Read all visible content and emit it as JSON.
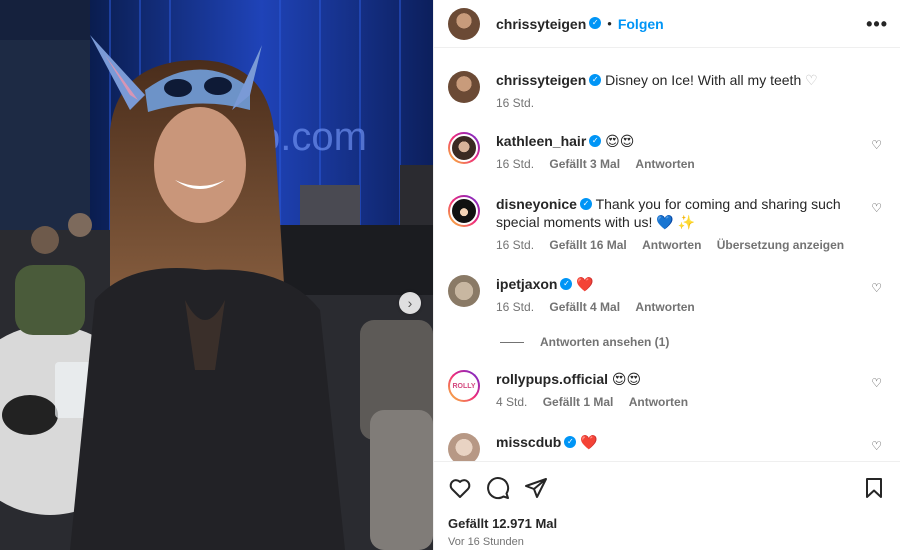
{
  "post": {
    "author": "chrissyteigen",
    "follow_label": "Folgen",
    "more_label": "•••",
    "carousel_next": "›"
  },
  "comments": [
    {
      "user": "chrissyteigen",
      "text": "Disney on Ice! With all my teeth",
      "trail": "♡",
      "time": "16 Std.",
      "likes": "",
      "reply": "",
      "translate": ""
    },
    {
      "user": "kathleen_hair",
      "text": "",
      "trail": "😍😍",
      "time": "16 Std.",
      "likes": "Gefällt 3 Mal",
      "reply": "Antworten",
      "translate": ""
    },
    {
      "user": "disneyonice",
      "text": "Thank you for coming and sharing such special moments with us!",
      "trail": "💙 ✨",
      "time": "16 Std.",
      "likes": "Gefällt 16 Mal",
      "reply": "Antworten",
      "translate": "Übersetzung anzeigen"
    },
    {
      "user": "ipetjaxon",
      "text": "",
      "trail": "❤️",
      "time": "16 Std.",
      "likes": "Gefällt 4 Mal",
      "reply": "Antworten",
      "translate": ""
    },
    {
      "user": "rollypups.official",
      "text": "",
      "trail": "😍😍",
      "time": "4 Std.",
      "likes": "Gefällt 1 Mal",
      "reply": "Antworten",
      "translate": ""
    },
    {
      "user": "misscdub",
      "text": "",
      "trail": "❤️",
      "time": "",
      "likes": "",
      "reply": "",
      "translate": ""
    }
  ],
  "view_replies": "Antworten ansehen (1)",
  "rolly_avatar_text": "ROLLY",
  "footer": {
    "likes": "Gefällt 12.971 Mal",
    "date": "Vor 16 Stunden"
  },
  "colors": {
    "link": "#0095f6",
    "muted": "#737373",
    "verified": "#0095f6",
    "heart": "#e0245e"
  },
  "icons": [
    "heart-icon",
    "comment-icon",
    "share-icon",
    "bookmark-icon",
    "more-icon",
    "verified-icon",
    "chevron-right-icon"
  ]
}
